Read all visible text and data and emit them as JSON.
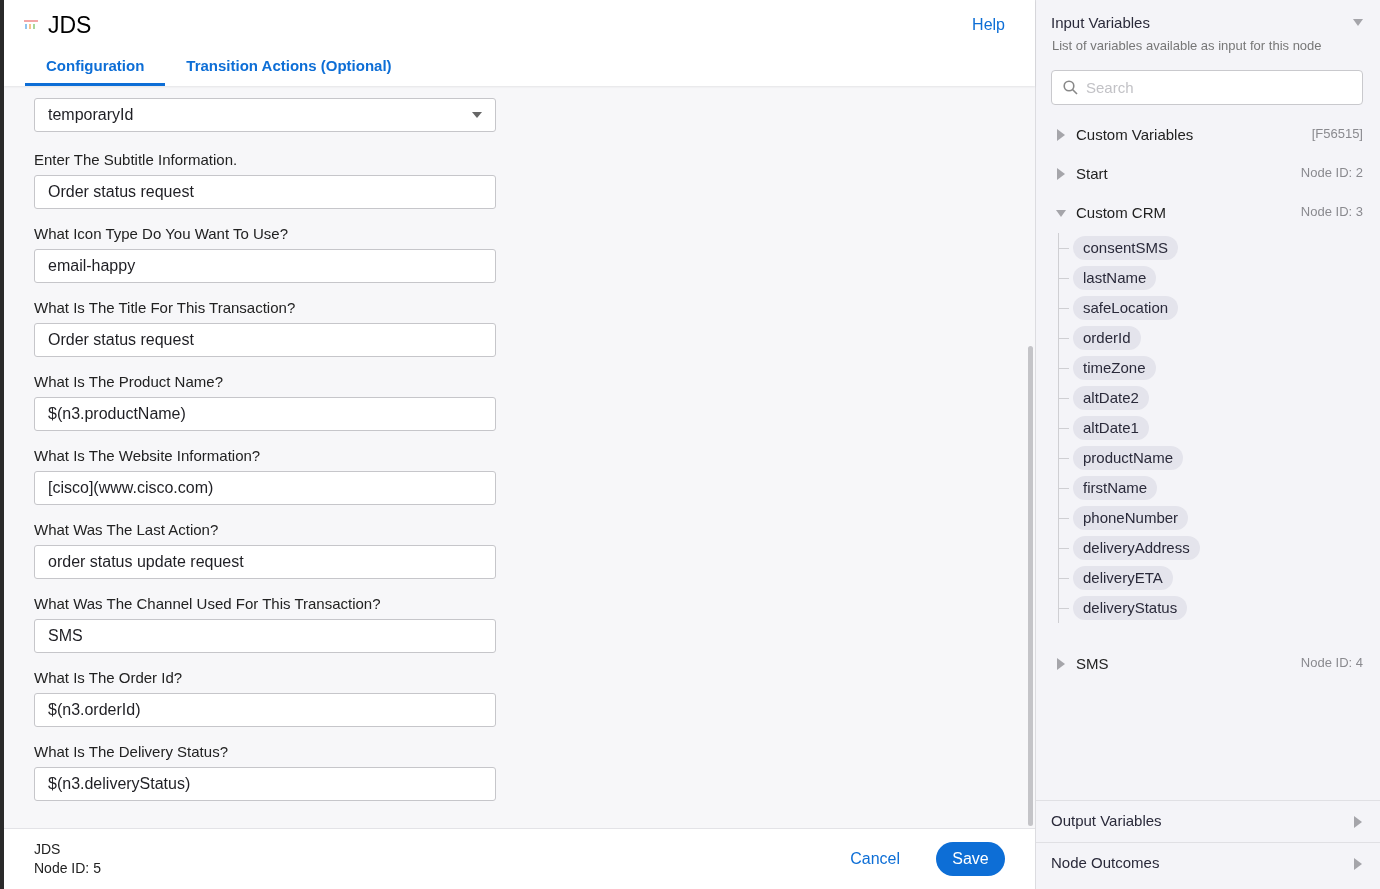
{
  "header": {
    "title": "JDS",
    "help": "Help"
  },
  "tabs": [
    {
      "label": "Configuration",
      "selected": true
    },
    {
      "label": "Transition Actions (Optional)",
      "selected": false
    }
  ],
  "fields": [
    {
      "kind": "dropdown",
      "value": "temporaryId"
    },
    {
      "kind": "text",
      "label": "Enter The Subtitle Information.",
      "value": "Order status request"
    },
    {
      "kind": "text",
      "label": "What Icon Type Do You Want To Use?",
      "value": "email-happy"
    },
    {
      "kind": "text",
      "label": "What Is The Title For This Transaction?",
      "value": "Order status request"
    },
    {
      "kind": "text",
      "label": "What Is The Product Name?",
      "value": "$(n3.productName)"
    },
    {
      "kind": "text",
      "label": "What Is The Website Information?",
      "value": "[cisco](www.cisco.com)"
    },
    {
      "kind": "text",
      "label": "What Was The Last Action?",
      "value": "order status update request"
    },
    {
      "kind": "text",
      "label": "What Was The Channel Used For This Transaction?",
      "value": "SMS"
    },
    {
      "kind": "text",
      "label": "What Is The Order Id?",
      "value": "$(n3.orderId)"
    },
    {
      "kind": "text",
      "label": "What Is The Delivery Status?",
      "value": "$(n3.deliveryStatus)"
    }
  ],
  "footer": {
    "name": "JDS",
    "node_id": "Node ID: 5",
    "cancel": "Cancel",
    "save": "Save"
  },
  "input_variables": {
    "title": "Input Variables",
    "subtitle": "List of variables available as input for this node",
    "search_placeholder": "Search",
    "groups": [
      {
        "name": "Custom Variables",
        "info": "[F56515]",
        "expanded": false
      },
      {
        "name": "Start",
        "info": "Node ID: 2",
        "expanded": false
      },
      {
        "name": "Custom CRM",
        "info": "Node ID: 3",
        "expanded": true,
        "children": [
          "consentSMS",
          "lastName",
          "safeLocation",
          "orderId",
          "timeZone",
          "altDate2",
          "altDate1",
          "productName",
          "firstName",
          "phoneNumber",
          "deliveryAddress",
          "deliveryETA",
          "deliveryStatus"
        ]
      },
      {
        "name": "SMS",
        "info": "Node ID: 4",
        "expanded": false
      }
    ]
  },
  "sections": [
    "Output Variables",
    "Node Outcomes"
  ]
}
